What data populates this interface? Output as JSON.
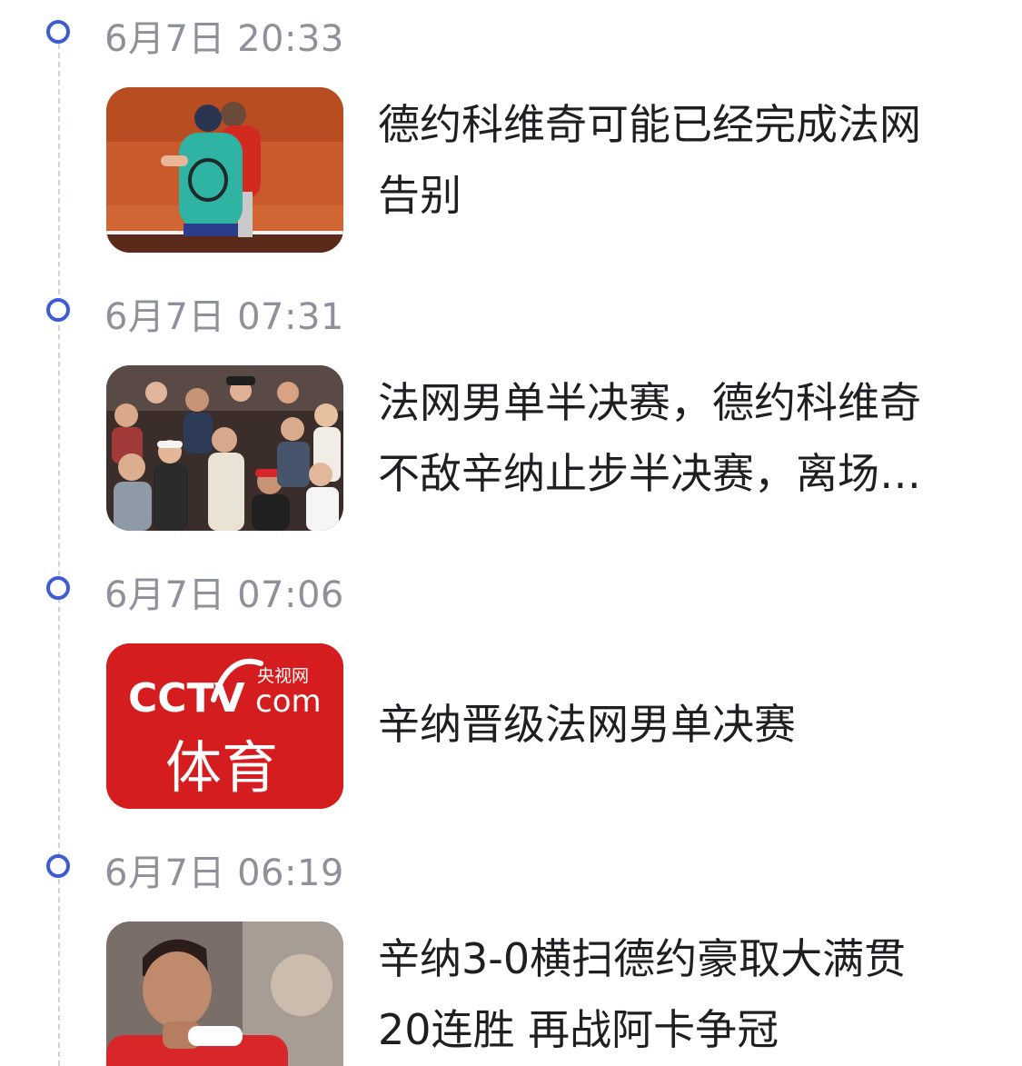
{
  "timeline": {
    "entries": [
      {
        "time": "6月7日 20:33",
        "headline": "德约科维奇可能已经完成法网告别",
        "thumb": "tennis-players-hug-photo"
      },
      {
        "time": "6月7日 07:31",
        "headline": "法网男单半决赛，德约科维奇不敌辛纳止步半决赛，离场…",
        "thumb": "crowd-applause-photo"
      },
      {
        "time": "6月7日 07:06",
        "headline": "辛纳晋级法网男单决赛",
        "thumb": "cctv-sports-logo",
        "logo": {
          "brand": "CCTV",
          "domain": "com",
          "site_name": "央视网",
          "channel": "体育",
          "bg_color": "#d51d1f"
        }
      },
      {
        "time": "6月7日 06:19",
        "headline": "辛纳3-0横扫德约豪取大满贯20连胜 再战阿卡争冠",
        "thumb": "player-fist-pump-photo"
      }
    ]
  },
  "colors": {
    "accent": "#3d5bd6",
    "time_text": "#8e9199",
    "headline_text": "#1e1f22",
    "timeline_line": "#cfd3da"
  }
}
